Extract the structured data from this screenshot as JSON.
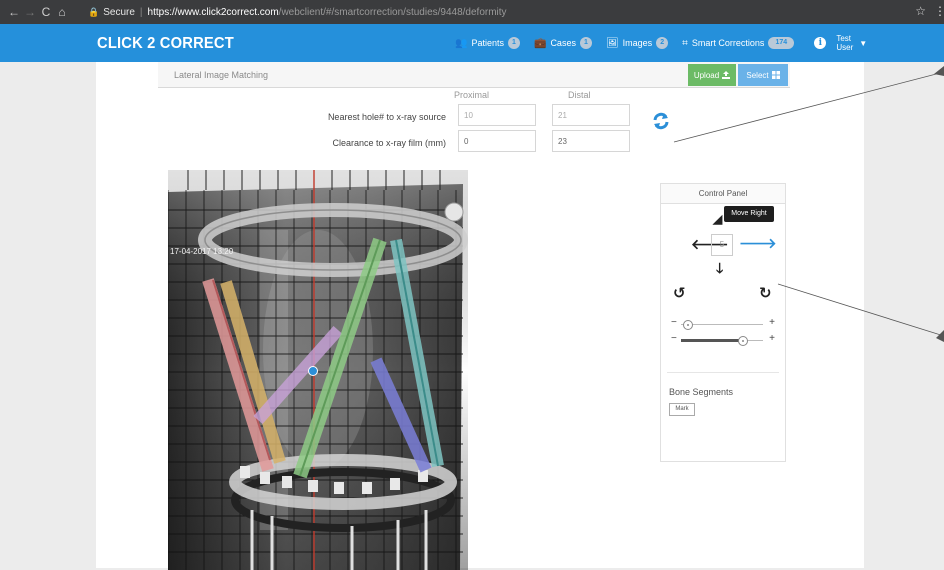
{
  "browser": {
    "secure_label": "Secure",
    "url_host": "https://www.click2correct.com",
    "url_path": "/webclient/#/smartcorrection/studies/9448/deformity"
  },
  "app": {
    "logo": "CLICK 2 CORRECT",
    "nav": [
      {
        "label": "Patients",
        "badge": "1",
        "icon": "users-icon"
      },
      {
        "label": "Cases",
        "badge": "1",
        "icon": "briefcase-icon"
      },
      {
        "label": "Images",
        "badge": "2",
        "icon": "image-icon"
      },
      {
        "label": "Smart Corrections",
        "badge": "174",
        "icon": "scan-icon"
      }
    ],
    "user_line1": "Test",
    "user_line2": "User"
  },
  "panel": {
    "title": "Lateral Image Matching",
    "upload_label": "Upload",
    "select_label": "Select",
    "col_proximal": "Proximal",
    "col_distal": "Distal",
    "row1_label": "Nearest hole# to x-ray source",
    "row2_label": "Clearance to x-ray film (mm)",
    "row1_proximal": "10",
    "row1_distal": "21",
    "row2_proximal": "0",
    "row2_distal": "23"
  },
  "xray": {
    "date_text": "17-04-2017 13:20"
  },
  "control_panel": {
    "title": "Control Panel",
    "tooltip": "Move Right",
    "step_value": "5",
    "bone_segments_label": "Bone Segments",
    "mark_label": "Mark",
    "slider1_value": 0.08,
    "slider2_value": 0.75
  },
  "colors": {
    "appbar": "#2590db",
    "accent_arrow": "#2b8fd8",
    "upload": "#6cbb66",
    "select": "#6ab2e8"
  }
}
